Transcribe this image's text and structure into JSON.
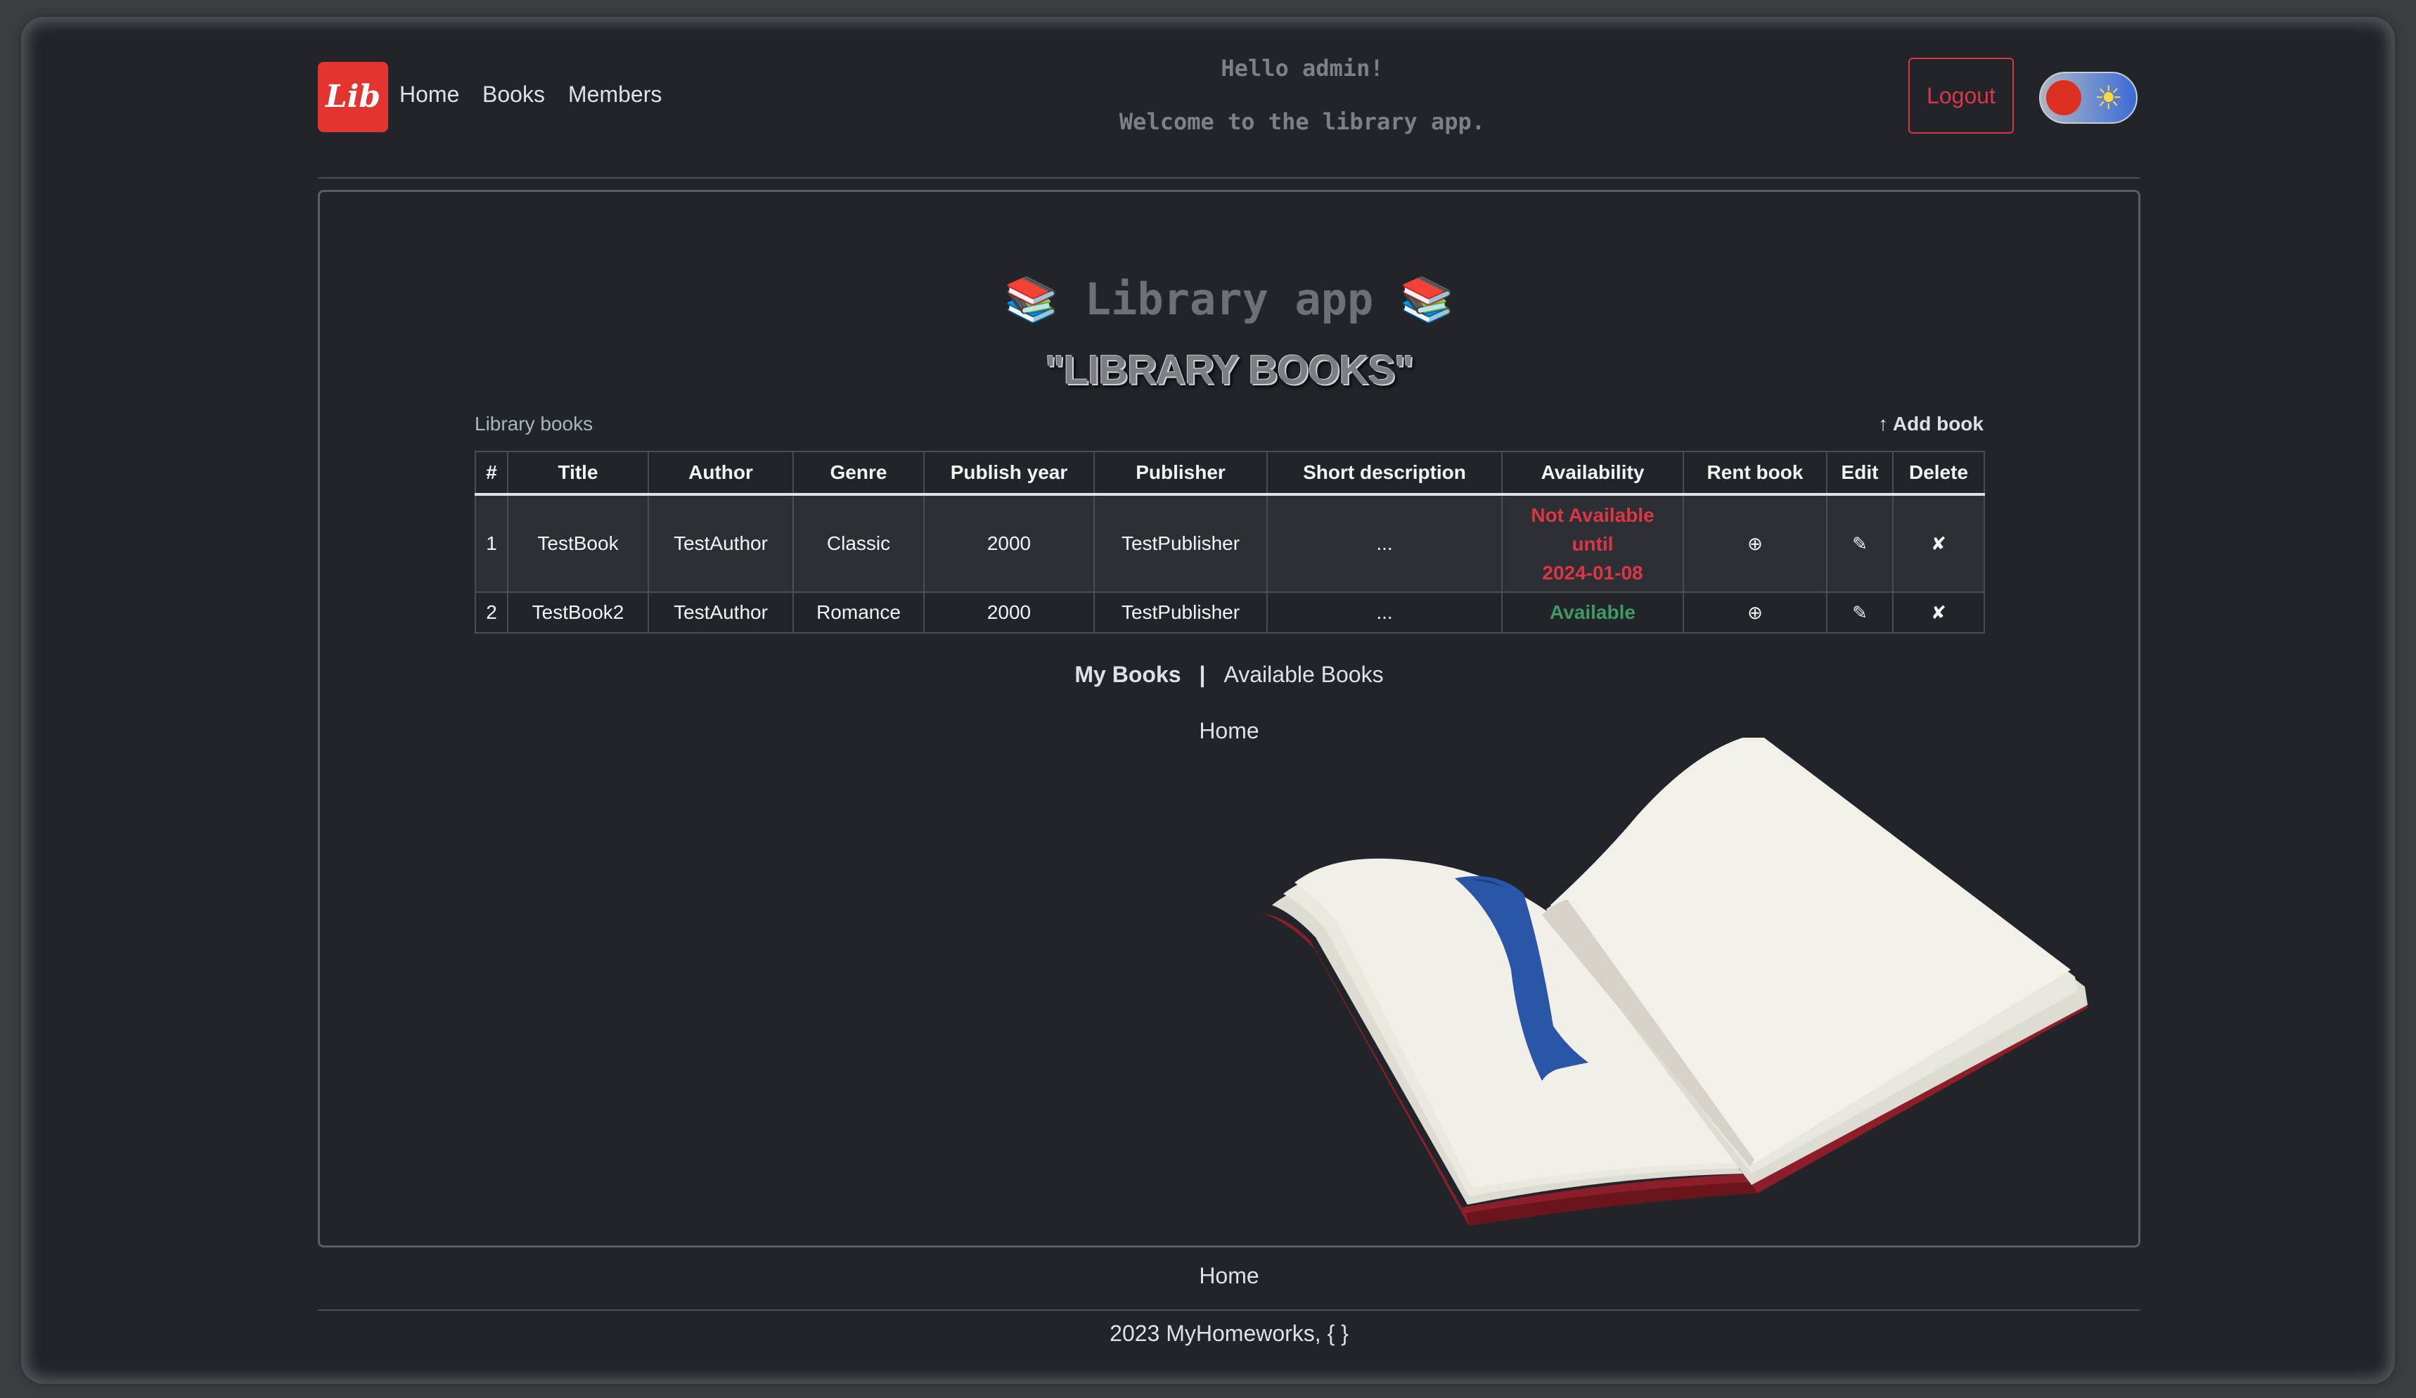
{
  "header": {
    "logo_text": "Lib",
    "nav": [
      "Home",
      "Books",
      "Members"
    ],
    "greeting": "Hello admin!",
    "welcome": "Welcome to the library app.",
    "logout_label": "Logout",
    "theme_toggle": {
      "knob_color": "#dc3023",
      "icon": "sun-icon"
    }
  },
  "main": {
    "app_title": "📚 Library app 📚",
    "heading": "\"LIBRARY BOOKS\"",
    "table_caption": "Library books",
    "add_book_label": "↑ Add book",
    "columns": [
      "#",
      "Title",
      "Author",
      "Genre",
      "Publish year",
      "Publisher",
      "Short description",
      "Availability",
      "Rent book",
      "Edit",
      "Delete"
    ],
    "rows": [
      {
        "num": "1",
        "title": "TestBook",
        "author": "TestAuthor",
        "genre": "Classic",
        "year": "2000",
        "publisher": "TestPublisher",
        "description": "...",
        "availability": [
          "Not Available",
          "until",
          "2024-01-08"
        ],
        "rent": "⊕",
        "edit": "✎",
        "delete": "✘"
      },
      {
        "num": "2",
        "title": "TestBook2",
        "author": "TestAuthor",
        "genre": "Romance",
        "year": "2000",
        "publisher": "TestPublisher",
        "description": "...",
        "availability": [
          "Available"
        ],
        "rent": "⊕",
        "edit": "✎",
        "delete": "✘"
      }
    ],
    "links": {
      "my_books": "My Books",
      "separator": "|",
      "available_books": "Available Books"
    },
    "home_link": "Home"
  },
  "footer": {
    "home_link": "Home",
    "copyright": "2023 MyHomeworks, { }"
  },
  "colors": {
    "background": "#212529",
    "logo": "#e3342f",
    "danger": "#dc3545",
    "success": "#3f9a63",
    "book_cover": "#8b1e28",
    "bookmark": "#2a56a8"
  }
}
